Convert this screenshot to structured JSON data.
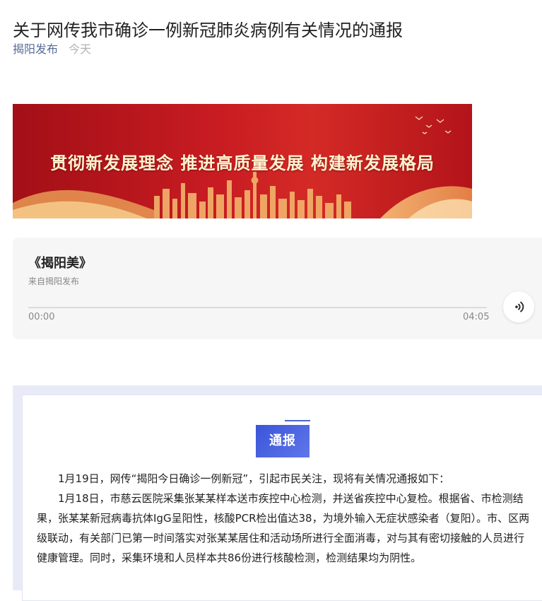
{
  "article": {
    "title": "关于网传我市确诊一例新冠肺炎病例有关情况的通报",
    "source": "揭阳发布",
    "time": "今天"
  },
  "banner": {
    "slogan": "贯彻新发展理念  推进高质量发展  构建新发展格局",
    "colors": {
      "red": "#c81c22",
      "gold": "#f0b060"
    }
  },
  "audio": {
    "title": "《揭阳美》",
    "subtitle": "来自揭阳发布",
    "current_time": "00:00",
    "duration": "04:05",
    "progress": 0,
    "play_icon": "sound-wave-icon"
  },
  "notice": {
    "tag": "通报",
    "paragraphs": [
      "1月19日，网传“揭阳今日确诊一例新冠”，引起市民关注，现将有关情况通报如下：",
      "1月18日，市慈云医院采集张某某样本送市疾控中心检测，并送省疾控中心复检。根据省、市检测结果，张某某新冠病毒抗体IgG呈阳性，核酸PCR检出值达38，为境外输入无症状感染者（复阳）。市、区两级联动，有关部门已第一时间落实对张某某居住和活动场所进行全面消毒，对与其有密切接触的人员进行健康管理。同时，采集环境和人员样本共86份进行核酸检测，检测结果均为阴性。"
    ]
  }
}
